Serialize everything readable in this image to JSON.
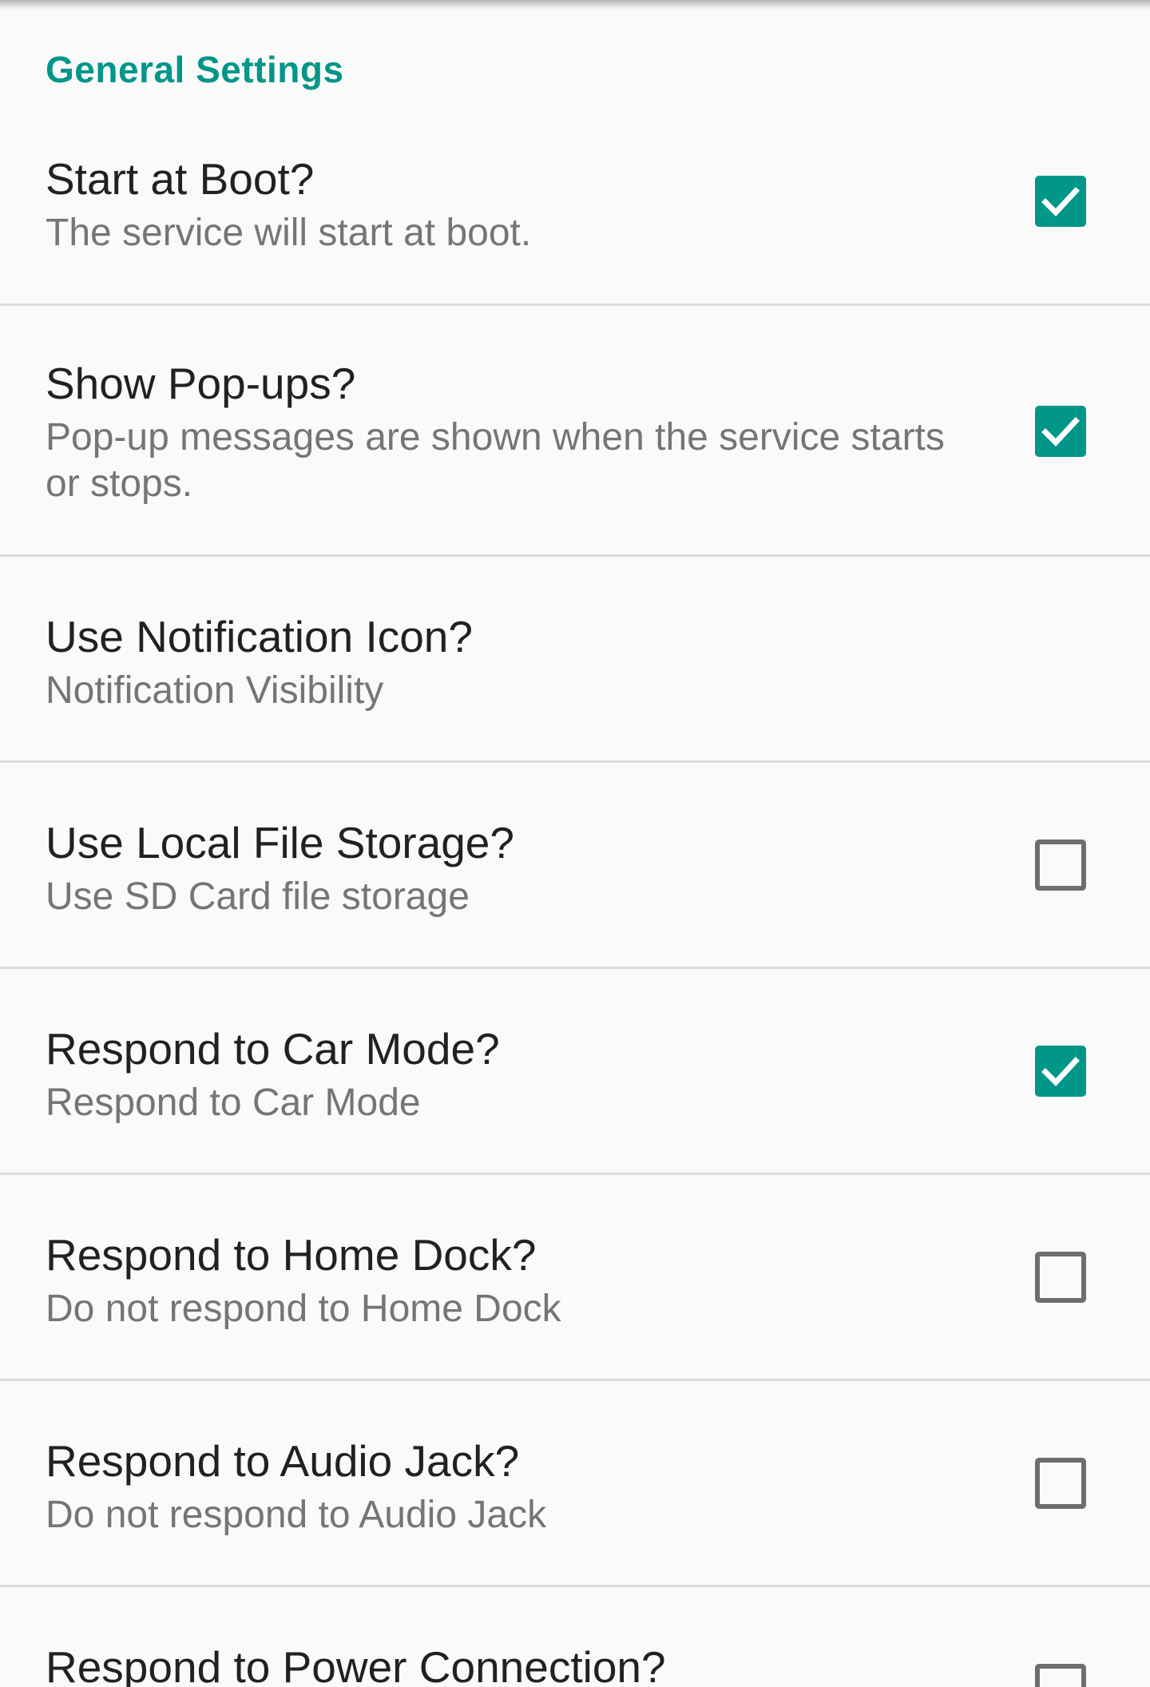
{
  "section": {
    "header": "General Settings"
  },
  "settings": [
    {
      "title": "Start at Boot?",
      "summary": "The service will start at boot.",
      "checked": true
    },
    {
      "title": "Show Pop-ups?",
      "summary": "Pop-up messages are shown when the service starts or stops.",
      "checked": true
    },
    {
      "title": "Use Notification Icon?",
      "summary": "Notification Visibility",
      "checked": null
    },
    {
      "title": "Use Local File Storage?",
      "summary": "Use SD Card file storage",
      "checked": false
    },
    {
      "title": "Respond to Car Mode?",
      "summary": "Respond to Car Mode",
      "checked": true
    },
    {
      "title": "Respond to Home Dock?",
      "summary": "Do not respond to Home Dock",
      "checked": false
    },
    {
      "title": "Respond to Audio Jack?",
      "summary": "Do not respond to Audio Jack",
      "checked": false
    },
    {
      "title": "Respond to Power Connection?",
      "summary": "",
      "checked": false
    }
  ],
  "colors": {
    "accent": "#009688",
    "title": "#212121",
    "summary": "#757575",
    "divider": "#dcdcdc"
  }
}
